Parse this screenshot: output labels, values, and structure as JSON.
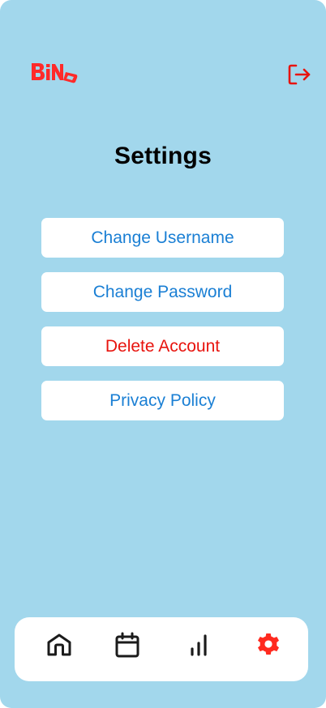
{
  "header": {
    "logo_text": "BiNG",
    "logo_icon": "bing-logo",
    "logout_icon": "logout-icon"
  },
  "page": {
    "title": "Settings"
  },
  "settings_menu": {
    "items": [
      {
        "label": "Change Username",
        "color": "#1a7fd4"
      },
      {
        "label": "Change Password",
        "color": "#1a7fd4"
      },
      {
        "label": "Delete Account",
        "color": "#e8140e"
      },
      {
        "label": "Privacy Policy",
        "color": "#1a7fd4"
      }
    ]
  },
  "bottom_nav": {
    "items": [
      {
        "icon": "home-icon",
        "active": false
      },
      {
        "icon": "calendar-icon",
        "active": false
      },
      {
        "icon": "stats-icon",
        "active": false
      },
      {
        "icon": "gear-icon",
        "active": true
      }
    ],
    "active_color": "#ff2a1f",
    "inactive_color": "#1b1b1b"
  },
  "colors": {
    "background": "#a2d7ec",
    "accent": "#e8140e",
    "link": "#1a7fd4"
  }
}
